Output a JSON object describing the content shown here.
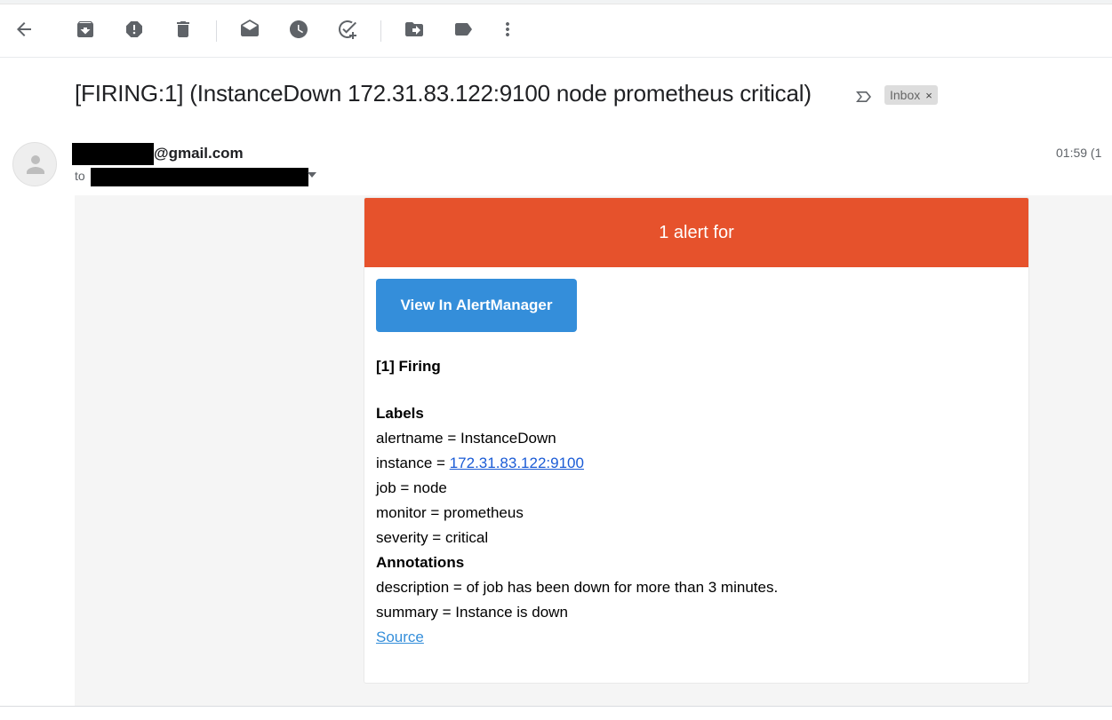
{
  "toolbar": {
    "icons": [
      "back-arrow-icon",
      "archive-icon",
      "report-spam-icon",
      "delete-icon",
      "mark-unread-icon",
      "snooze-icon",
      "add-task-icon",
      "move-to-icon",
      "label-icon",
      "more-vert-icon"
    ]
  },
  "email": {
    "subject": "[FIRING:1] (InstanceDown 172.31.83.122:9100 node prometheus critical)",
    "label": "Inbox",
    "label_remove": "×",
    "sender_suffix": "@gmail.com",
    "to_prefix": "to",
    "time": "01:59 (1"
  },
  "alert": {
    "header": "1 alert for",
    "button": "View In AlertManager",
    "firing_title": "[1] Firing",
    "labels_title": "Labels",
    "alertname": "alertname = InstanceDown",
    "instance_prefix": "instance = ",
    "instance_link": "172.31.83.122:9100",
    "job": "job = node",
    "monitor": "monitor = prometheus",
    "severity": "severity = critical",
    "annotations_title": "Annotations",
    "description": "description = of job has been down for more than 3 minutes.",
    "summary": "summary = Instance is down",
    "source": "Source"
  },
  "colors": {
    "alert_header": "#e6522c",
    "button": "#348eda",
    "link": "#1a5bd6"
  }
}
